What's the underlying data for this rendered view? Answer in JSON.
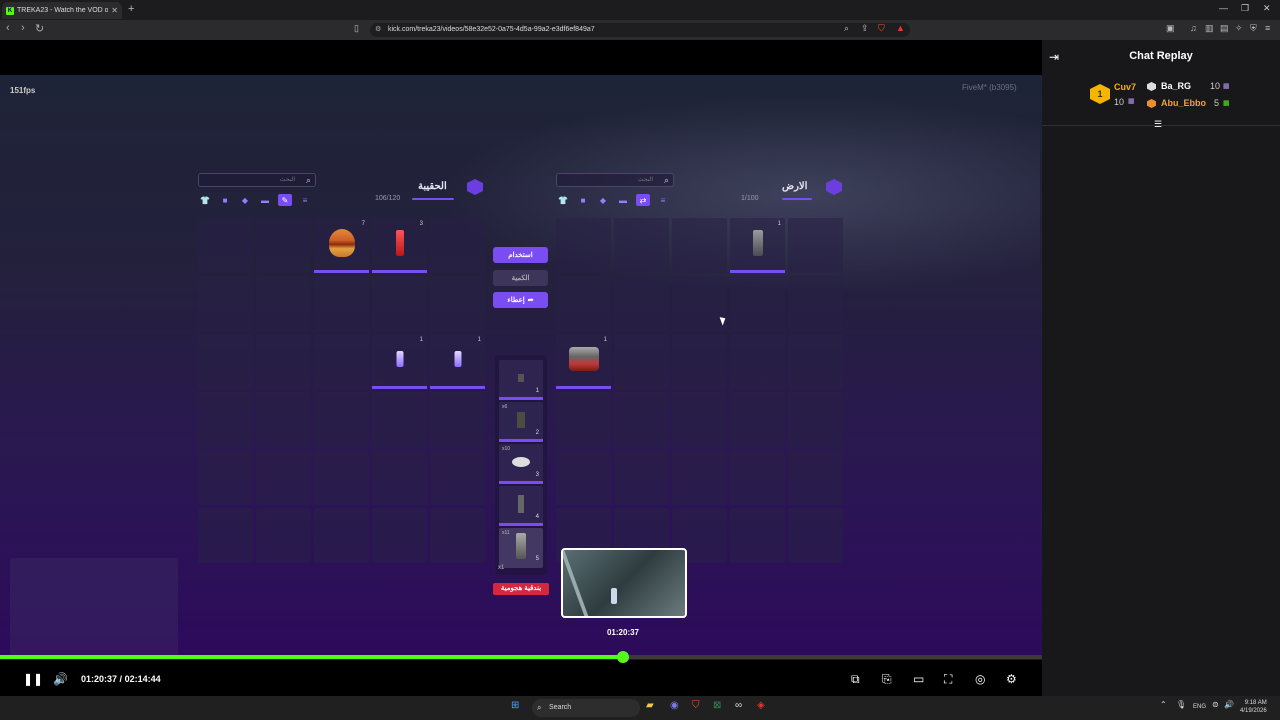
{
  "browser": {
    "tab_title": "TREKA23 - Watch the VOD on Kick",
    "tab_favicon": "K",
    "url": "kick.com/treka23/videos/58e32e52-0a75-4d5a-99a2-e3df6ef849a7",
    "accent": "#53fc18"
  },
  "game": {
    "fps": "151fps",
    "build": "FiveM* (b3095)",
    "bag": {
      "title": "الحقيبة",
      "search_placeholder": "البحث",
      "weight": "106/120",
      "items": [
        {
          "name": "burger",
          "count": "7"
        },
        {
          "name": "drink-can",
          "count": "3"
        },
        {
          "name": "phone",
          "count": "1"
        },
        {
          "name": "phone",
          "count": "1"
        }
      ]
    },
    "ground": {
      "title": "الارض",
      "search_placeholder": "البحث",
      "weight": "1/100",
      "items": [
        {
          "name": "magazine",
          "count": "1"
        },
        {
          "name": "engine-part",
          "count": "1"
        }
      ]
    },
    "actions": {
      "use": "استخدام",
      "amount": "الكمية",
      "give": "إعطاء"
    },
    "hotbar": [
      {
        "slot": "1",
        "qty": ""
      },
      {
        "slot": "2",
        "qty": "x6"
      },
      {
        "slot": "3",
        "qty": "x10"
      },
      {
        "slot": "4",
        "qty": ""
      },
      {
        "slot": "5",
        "qty": "x11"
      }
    ],
    "hotbar_footer": "x1",
    "equipped_label": "بندقية هجومية"
  },
  "player": {
    "current_time": "01:20:37",
    "duration": "02:14:44",
    "preview_time": "01:20:37",
    "progress": 0.598
  },
  "chat": {
    "title": "Chat Replay",
    "leaderboard": [
      {
        "rank": "1",
        "name": "Cuv7",
        "count": "10",
        "color": "#f5b400"
      },
      {
        "rank": "2",
        "name": "Ba_RG",
        "count": "10",
        "color": "#ffffff"
      },
      {
        "rank": "3",
        "name": "Abu_Ebbo",
        "count": "5",
        "color": "#f0a040"
      }
    ]
  },
  "taskbar": {
    "search": "Search",
    "lang": "ENG",
    "time": "9:18 AM",
    "date": "4/19/2026"
  }
}
